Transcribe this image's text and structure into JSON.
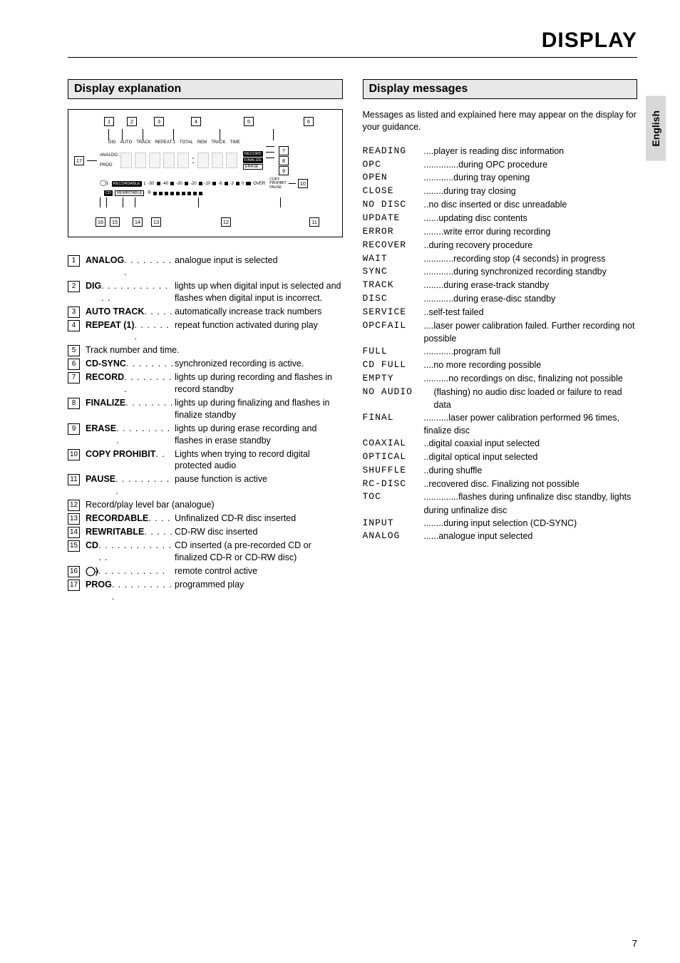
{
  "header": {
    "title": "DISPLAY"
  },
  "lang_tab": "English",
  "page_number": "7",
  "left": {
    "heading": "Display explanation",
    "diagram": {
      "top_callouts": [
        "1",
        "2",
        "3",
        "4",
        "5",
        "6"
      ],
      "top_labels": [
        "DIG",
        "AUTO",
        "TRACK",
        "REPEAT 1",
        "TOTAL",
        "REM",
        "TRACK",
        "TIME"
      ],
      "analog": "ANALOG",
      "prog": "PROG",
      "right_stack": [
        "RECORD",
        "FINALIZE",
        "ERASE"
      ],
      "right_extra_top": "COPY",
      "right_extra_mid": "PROHIBIT",
      "right_extra_bot": "PAUSE",
      "right_callouts": [
        "7",
        "8",
        "9",
        "10"
      ],
      "level_labels": [
        "L",
        "-50",
        "-40",
        "-30",
        "-20",
        "-10",
        "-6",
        "-3",
        "0",
        "OVER"
      ],
      "recordable": "RECORDABLE",
      "rewritable": "REWRITABLE",
      "cd": "CD",
      "bottom_callouts": [
        "16",
        "15",
        "14",
        "13",
        "12",
        "11"
      ],
      "left_callout": "17"
    },
    "items": [
      {
        "n": "1",
        "term": "ANALOG",
        "dots": ". . . . . . . . .",
        "desc": "analogue input is selected"
      },
      {
        "n": "2",
        "term": "DIG",
        "dots": ". . . . . . . . . . . . .",
        "desc": "lights up when digital input is selected and flashes when digital input is incorrect."
      },
      {
        "n": "3",
        "term": "AUTO TRACK",
        "dots": ". . . . .",
        "desc": "automatically increase track numbers"
      },
      {
        "n": "4",
        "term": "REPEAT (1)",
        "dots": ". . . . . . .",
        "desc": "repeat function activated during play"
      },
      {
        "n": "5",
        "term": "",
        "dots": "",
        "desc": "Track number and time."
      },
      {
        "n": "6",
        "term": "CD-SYNC",
        "dots": ". . . . . . . .",
        "desc": "synchronized recording is active."
      },
      {
        "n": "7",
        "term": "RECORD",
        "dots": ". . . . . . . . .",
        "desc": "lights up during recording and flashes in record standby"
      },
      {
        "n": "8",
        "term": "FINALIZE",
        "dots": ". . . . . . . .",
        "desc": "lights up during finalizing and flashes in finalize standby"
      },
      {
        "n": "9",
        "term": "ERASE",
        "dots": ". . . . . . . . . .",
        "desc": "lights up during erase recording and flashes in erase standby"
      },
      {
        "n": "10",
        "term": "COPY PROHIBIT",
        "dots": ". .",
        "desc": "Lights when trying to record digital protected audio"
      },
      {
        "n": "11",
        "term": "PAUSE",
        "dots": ". . . . . . . . . .",
        "desc": "pause function is active"
      },
      {
        "n": "12",
        "term": "",
        "dots": "",
        "desc": "Record/play level bar (analogue)"
      },
      {
        "n": "13",
        "term": "RECORDABLE",
        "dots": ". . . .",
        "desc": "Unfinalized CD-R disc inserted"
      },
      {
        "n": "14",
        "term": "REWRITABLE",
        "dots": ". . . . .",
        "desc": "CD-RW disc inserted"
      },
      {
        "n": "15",
        "term": "CD",
        "dots": ". . . . . . . . . . . . . .",
        "desc": "CD inserted (a pre-recorded CD or finalized CD-R or CD-RW disc)"
      },
      {
        "n": "16",
        "term": "B",
        "dots": ". . . . . . . . . . .",
        "desc": "remote control active",
        "icon": true
      },
      {
        "n": "17",
        "term": "PROG",
        "dots": ". . . . . . . . . . .",
        "desc": "programmed play"
      }
    ]
  },
  "right": {
    "heading": "Display messages",
    "intro": "Messages as listed and explained here may appear on the display for your guidance.",
    "messages": [
      {
        "code": "READING",
        "dots": "....",
        "desc": "player is reading disc information"
      },
      {
        "code": "OPC",
        "dots": "..............",
        "desc": "during OPC procedure"
      },
      {
        "code": "OPEN",
        "dots": "............",
        "desc": "during tray opening"
      },
      {
        "code": "CLOSE",
        "dots": "........",
        "desc": "during tray closing"
      },
      {
        "code": "NO DISC",
        "dots": "..",
        "desc": "no disc inserted or disc unreadable"
      },
      {
        "code": "UPDATE",
        "dots": "......",
        "desc": "updating disc contents"
      },
      {
        "code": "ERROR",
        "dots": "........",
        "desc": "write error during recording"
      },
      {
        "code": "RECOVER",
        "dots": "..",
        "desc": "during recovery procedure"
      },
      {
        "code": "WAIT",
        "dots": "............",
        "desc": "recording stop (4 seconds) in progress"
      },
      {
        "code": "SYNC",
        "dots": "............",
        "desc": "during synchronized recording standby"
      },
      {
        "code": "TRACK",
        "dots": "........",
        "desc": "during erase-track standby"
      },
      {
        "code": "DISC",
        "dots": "............",
        "desc": "during erase-disc standby"
      },
      {
        "code": "SERVICE",
        "dots": "..",
        "desc": "self-test failed"
      },
      {
        "code": "OPCFAIL",
        "dots": "....",
        "desc": "laser power calibration failed.  Further recording not possible"
      },
      {
        "code": "FULL",
        "dots": "............",
        "desc": "program full"
      },
      {
        "code": "CD FULL",
        "dots": "....",
        "desc": "no more recording possible"
      },
      {
        "code": "EMPTY",
        "dots": "..........",
        "desc": "no recordings on disc, finalizing not possible"
      },
      {
        "code": "NO AUDIO",
        "dots": "",
        "desc": "(flashing) no audio disc loaded or failure to read data",
        "wide": true
      },
      {
        "code": "FINAL",
        "dots": "..........",
        "desc": "laser power calibration performed 96 times, finalize disc"
      },
      {
        "code": "COAXIAL",
        "dots": "..",
        "desc": "digital coaxial input selected"
      },
      {
        "code": "OPTICAL",
        "dots": "..",
        "desc": "digital optical input selected"
      },
      {
        "code": "SHUFFLE",
        "dots": "..",
        "desc": "during shuffle"
      },
      {
        "code": "RC-DISC",
        "dots": "..",
        "desc": "recovered disc. Finalizing not possible"
      },
      {
        "code": "TOC",
        "dots": "..............",
        "desc": "flashes during unfinalize disc standby, lights during unfinalize disc"
      },
      {
        "code": "INPUT",
        "dots": "........",
        "desc": "during input selection (CD-SYNC)"
      },
      {
        "code": "ANALOG",
        "dots": "......",
        "desc": "analogue input selected"
      }
    ]
  }
}
